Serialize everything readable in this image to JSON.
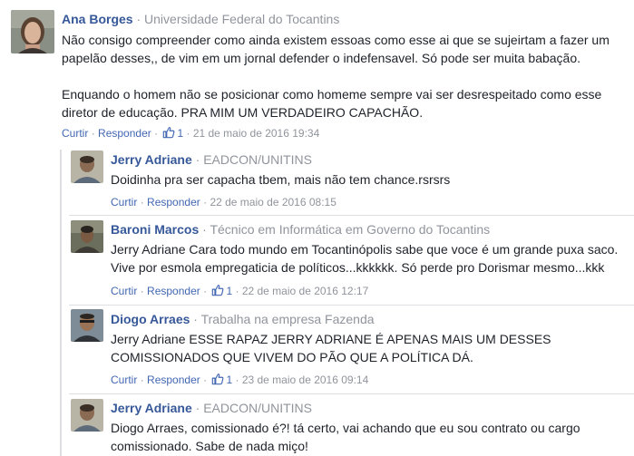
{
  "comments": [
    {
      "name": "Ana Borges",
      "affiliation": "Universidade Federal do Tocantins",
      "lines": [
        "Não consigo compreender como ainda existem essoas como esse ai que se sujeirtam a fazer um",
        "papelão desses,, de vim em um jornal defender o indefensavel. Só pode ser muita babação.",
        "",
        "Enquando o homem não se posicionar como homeme sempre vai ser desrespeitado como esse",
        "diretor de educação. PRA MIM UM VERDADEIRO CAPACHÃO."
      ],
      "like_label": "Curtir",
      "reply_label": "Responder",
      "likes": "1",
      "timestamp": "21 de maio de 2016 19:34"
    },
    {
      "name": "Jerry Adriane",
      "affiliation": "EADCON/UNITINS",
      "lines": [
        "Doidinha pra ser capacha tbem, mais não tem chance.rsrsrs"
      ],
      "like_label": "Curtir",
      "reply_label": "Responder",
      "likes": "",
      "timestamp": "22 de maio de 2016 08:15"
    },
    {
      "name": "Baroni Marcos",
      "affiliation": "Técnico em Informática em Governo do Tocantins",
      "lines": [
        "Jerry Adriane Cara todo mundo em Tocantinópolis sabe que voce é um grande puxa saco.",
        "Vive por esmola empregaticia de políticos...kkkkkk. Só perde pro Dorismar mesmo...kkk"
      ],
      "like_label": "Curtir",
      "reply_label": "Responder",
      "likes": "1",
      "timestamp": "22 de maio de 2016 12:17"
    },
    {
      "name": "Diogo Arraes",
      "affiliation": "Trabalha na empresa Fazenda",
      "lines": [
        "Jerry Adriane ESSE RAPAZ JERRY ADRIANE É APENAS MAIS UM DESSES",
        "COMISSIONADOS QUE VIVEM DO PÃO QUE A POLÍTICA DÁ."
      ],
      "like_label": "Curtir",
      "reply_label": "Responder",
      "likes": "1",
      "timestamp": "23 de maio de 2016 09:14"
    },
    {
      "name": "Jerry Adriane",
      "affiliation": "EADCON/UNITINS",
      "lines": [
        "Diogo Arraes, comissionado é?! tá certo, vai achando que eu sou contrato ou cargo",
        "comissionado. Sabe de nada miço!"
      ],
      "like_label": "",
      "reply_label": "",
      "likes": "",
      "timestamp": ""
    }
  ],
  "separator": "·",
  "icons": {
    "like": "thumbs-up-icon",
    "avatar": "profile-photo"
  },
  "colors": {
    "name": "#365899",
    "link": "#4267b2",
    "meta": "#90949c",
    "text": "#1d2129"
  }
}
